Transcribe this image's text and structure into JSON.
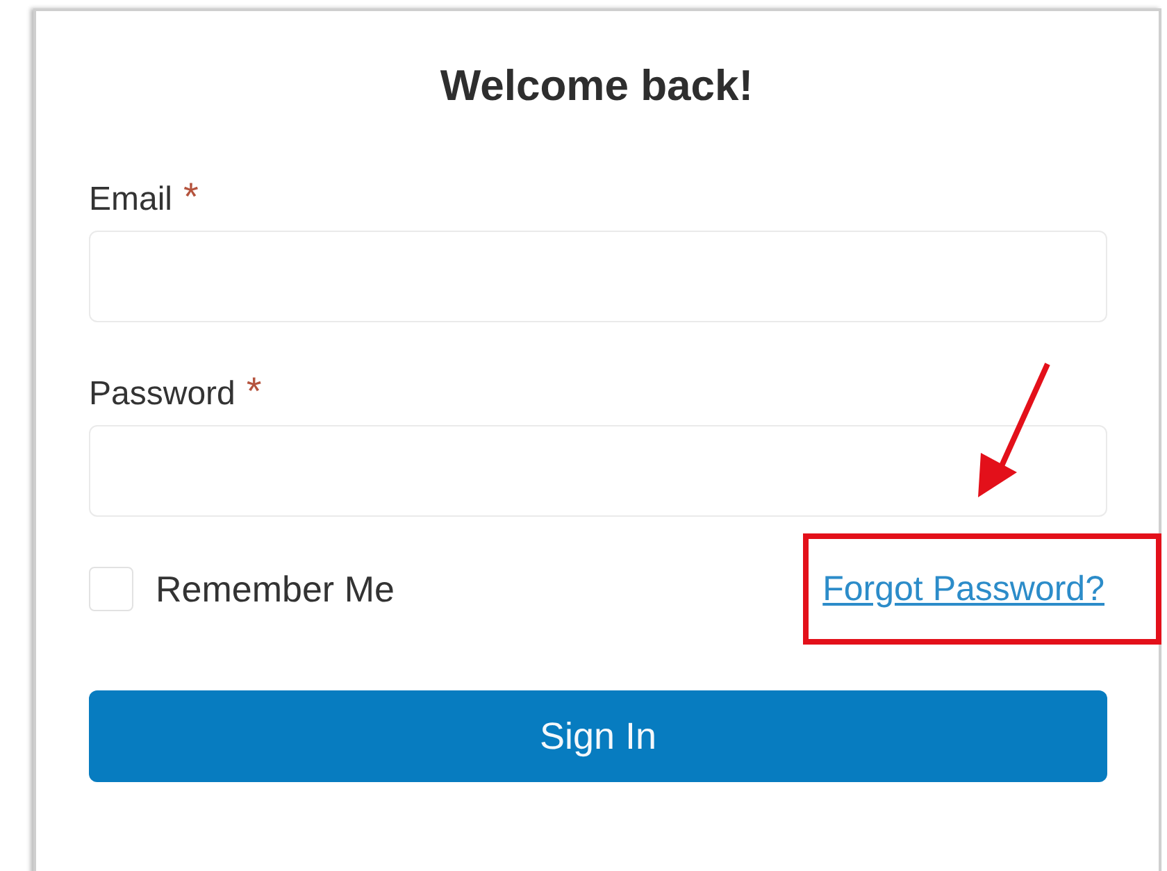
{
  "title": "Welcome back!",
  "fields": [
    {
      "label": "Email",
      "required_mark": "*"
    },
    {
      "label": "Password",
      "required_mark": "*"
    }
  ],
  "remember": {
    "label": "Remember Me",
    "checked": false
  },
  "forgot_link": {
    "label": "Forgot Password?",
    "highlighted": true
  },
  "submit": {
    "label": "Sign In"
  }
}
